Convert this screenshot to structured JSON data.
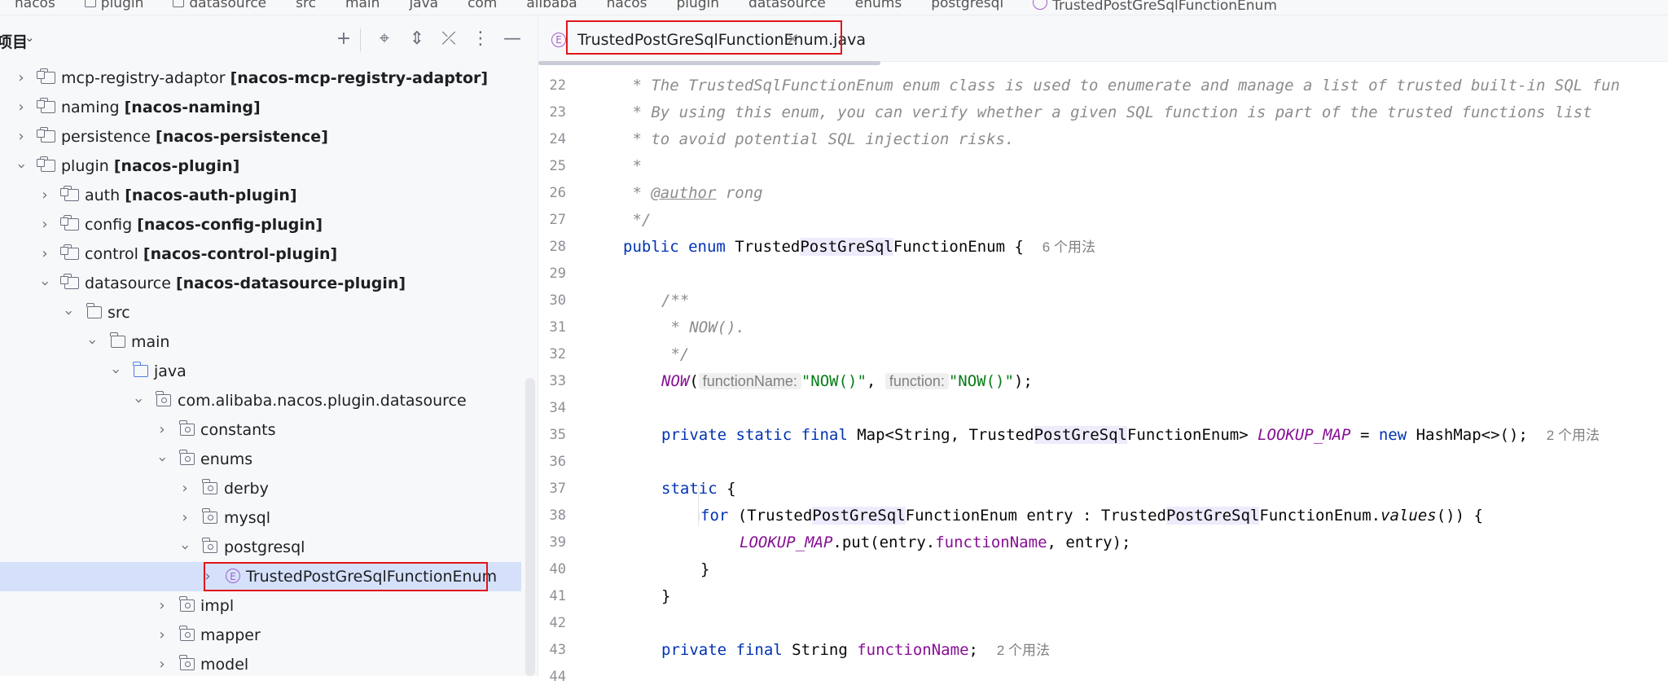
{
  "breadcrumb": [
    "nacos",
    "plugin",
    "datasource",
    "src",
    "main",
    "java",
    "com",
    "alibaba",
    "nacos",
    "plugin",
    "datasource",
    "enums",
    "postgresql",
    "TrustedPostGreSqlFunctionEnum"
  ],
  "project_panel": {
    "title": "项目",
    "toolbar": [
      "add-icon",
      "locate-icon",
      "expand-all-icon",
      "collapse-all-icon",
      "more-icon",
      "minimize-icon"
    ],
    "tree": [
      {
        "name": "mcp-registry-adaptor",
        "module": "[nacos-mcp-registry-adaptor]",
        "expanded": false
      },
      {
        "name": "naming",
        "module": "[nacos-naming]",
        "expanded": false
      },
      {
        "name": "persistence",
        "module": "[nacos-persistence]",
        "expanded": false
      },
      {
        "name": "plugin",
        "module": "[nacos-plugin]",
        "expanded": true
      },
      {
        "name": "auth",
        "module": "[nacos-auth-plugin]",
        "expanded": false
      },
      {
        "name": "config",
        "module": "[nacos-config-plugin]",
        "expanded": false
      },
      {
        "name": "control",
        "module": "[nacos-control-plugin]",
        "expanded": false
      },
      {
        "name": "datasource",
        "module": "[nacos-datasource-plugin]",
        "expanded": true
      },
      {
        "name": "src",
        "module": "",
        "expanded": true
      },
      {
        "name": "main",
        "module": "",
        "expanded": true
      },
      {
        "name": "java",
        "module": "",
        "expanded": true
      },
      {
        "name": "com.alibaba.nacos.plugin.datasource",
        "module": "",
        "expanded": true
      },
      {
        "name": "constants",
        "module": "",
        "expanded": false
      },
      {
        "name": "enums",
        "module": "",
        "expanded": true
      },
      {
        "name": "derby",
        "module": "",
        "expanded": false
      },
      {
        "name": "mysql",
        "module": "",
        "expanded": false
      },
      {
        "name": "postgresql",
        "module": "",
        "expanded": true
      },
      {
        "name": "TrustedPostGreSqlFunctionEnum",
        "module": "",
        "expanded": false,
        "selected": true
      },
      {
        "name": "impl",
        "module": "",
        "expanded": false
      },
      {
        "name": "mapper",
        "module": "",
        "expanded": false
      },
      {
        "name": "model",
        "module": "",
        "expanded": false
      }
    ]
  },
  "editor": {
    "tab_label": "TrustedPostGreSqlFunctionEnum.java",
    "line_numbers": [
      "22",
      "23",
      "24",
      "25",
      "26",
      "27",
      "28",
      "29",
      "30",
      "31",
      "32",
      "33",
      "34",
      "35",
      "36",
      "37",
      "38",
      "39",
      "40",
      "41",
      "42",
      "43",
      "44"
    ],
    "code": {
      "l22": " * The TrustedSqlFunctionEnum enum class is used to enumerate and manage a list of trusted built-in SQL fun",
      "l23": " * By using this enum, you can verify whether a given SQL function is part of the trusted functions list",
      "l24": " * to avoid potential SQL injection risks.",
      "l25": " *",
      "l26_prefix": " * ",
      "l26_tag": "@author",
      "l26_rest": " rong",
      "l27": " */",
      "l28_kw": "public enum ",
      "l28_a": "Trusted",
      "l28_hl": "PostGreSql",
      "l28_b": "FunctionEnum {",
      "l28_hint": "6 个用法",
      "l30": "/**",
      "l31": " * NOW().",
      "l32": " */",
      "l33_const": "NOW",
      "l33_p1": "functionName:",
      "l33_s1": "\"NOW()\"",
      "l33_p2": "function:",
      "l33_s2": "\"NOW()\"",
      "l35_kw": "private static final ",
      "l35_a": "Map<String, Trusted",
      "l35_hl": "PostGreSql",
      "l35_b": "FunctionEnum> ",
      "l35_const": "LOOKUP_MAP",
      "l35_eq": " = ",
      "l35_new": "new",
      "l35_c": " HashMap<>();",
      "l35_hint": "2 个用法",
      "l37_kw": "static",
      "l37_rest": " {",
      "l38_kw": "for",
      "l38_a": " (Trusted",
      "l38_hl1": "PostGreSql",
      "l38_b": "FunctionEnum entry : Trusted",
      "l38_hl2": "PostGreSql",
      "l38_c": "FunctionEnum.",
      "l38_m": "values",
      "l38_d": "()) {",
      "l39_const": "LOOKUP_MAP",
      "l39_a": ".put(entry.",
      "l39_field": "functionName",
      "l39_b": ", entry);",
      "l40": "}",
      "l41": "}",
      "l43_kw": "private final ",
      "l43_a": "String ",
      "l43_field": "functionName",
      "l43_b": ";",
      "l43_hint": "2 个用法"
    }
  },
  "colors": {
    "highlight_box": "#e0161b",
    "selected_row": "#d5e1fb",
    "keyword": "#0033b3",
    "string": "#067d17",
    "constant": "#871094",
    "comment": "#8c8c8c"
  }
}
